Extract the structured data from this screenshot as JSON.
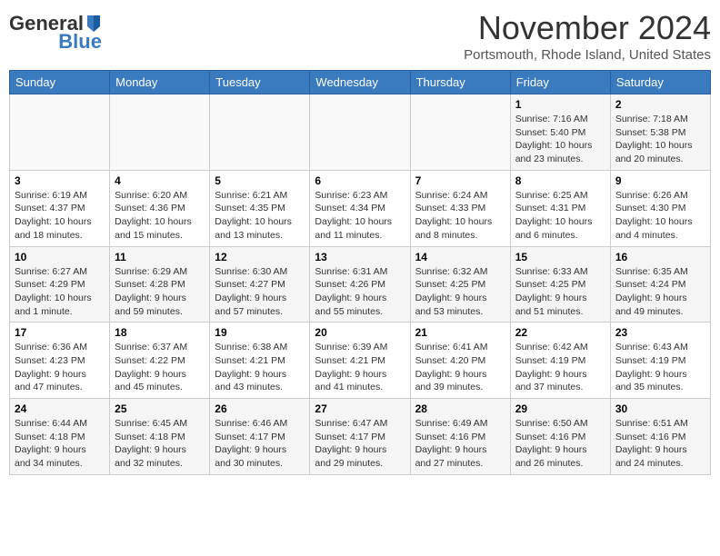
{
  "logo": {
    "general": "General",
    "blue": "Blue"
  },
  "header": {
    "month": "November 2024",
    "location": "Portsmouth, Rhode Island, United States"
  },
  "days_of_week": [
    "Sunday",
    "Monday",
    "Tuesday",
    "Wednesday",
    "Thursday",
    "Friday",
    "Saturday"
  ],
  "weeks": [
    [
      {
        "day": "",
        "info": ""
      },
      {
        "day": "",
        "info": ""
      },
      {
        "day": "",
        "info": ""
      },
      {
        "day": "",
        "info": ""
      },
      {
        "day": "",
        "info": ""
      },
      {
        "day": "1",
        "info": "Sunrise: 7:16 AM\nSunset: 5:40 PM\nDaylight: 10 hours and 23 minutes."
      },
      {
        "day": "2",
        "info": "Sunrise: 7:18 AM\nSunset: 5:38 PM\nDaylight: 10 hours and 20 minutes."
      }
    ],
    [
      {
        "day": "3",
        "info": "Sunrise: 6:19 AM\nSunset: 4:37 PM\nDaylight: 10 hours and 18 minutes."
      },
      {
        "day": "4",
        "info": "Sunrise: 6:20 AM\nSunset: 4:36 PM\nDaylight: 10 hours and 15 minutes."
      },
      {
        "day": "5",
        "info": "Sunrise: 6:21 AM\nSunset: 4:35 PM\nDaylight: 10 hours and 13 minutes."
      },
      {
        "day": "6",
        "info": "Sunrise: 6:23 AM\nSunset: 4:34 PM\nDaylight: 10 hours and 11 minutes."
      },
      {
        "day": "7",
        "info": "Sunrise: 6:24 AM\nSunset: 4:33 PM\nDaylight: 10 hours and 8 minutes."
      },
      {
        "day": "8",
        "info": "Sunrise: 6:25 AM\nSunset: 4:31 PM\nDaylight: 10 hours and 6 minutes."
      },
      {
        "day": "9",
        "info": "Sunrise: 6:26 AM\nSunset: 4:30 PM\nDaylight: 10 hours and 4 minutes."
      }
    ],
    [
      {
        "day": "10",
        "info": "Sunrise: 6:27 AM\nSunset: 4:29 PM\nDaylight: 10 hours and 1 minute."
      },
      {
        "day": "11",
        "info": "Sunrise: 6:29 AM\nSunset: 4:28 PM\nDaylight: 9 hours and 59 minutes."
      },
      {
        "day": "12",
        "info": "Sunrise: 6:30 AM\nSunset: 4:27 PM\nDaylight: 9 hours and 57 minutes."
      },
      {
        "day": "13",
        "info": "Sunrise: 6:31 AM\nSunset: 4:26 PM\nDaylight: 9 hours and 55 minutes."
      },
      {
        "day": "14",
        "info": "Sunrise: 6:32 AM\nSunset: 4:25 PM\nDaylight: 9 hours and 53 minutes."
      },
      {
        "day": "15",
        "info": "Sunrise: 6:33 AM\nSunset: 4:25 PM\nDaylight: 9 hours and 51 minutes."
      },
      {
        "day": "16",
        "info": "Sunrise: 6:35 AM\nSunset: 4:24 PM\nDaylight: 9 hours and 49 minutes."
      }
    ],
    [
      {
        "day": "17",
        "info": "Sunrise: 6:36 AM\nSunset: 4:23 PM\nDaylight: 9 hours and 47 minutes."
      },
      {
        "day": "18",
        "info": "Sunrise: 6:37 AM\nSunset: 4:22 PM\nDaylight: 9 hours and 45 minutes."
      },
      {
        "day": "19",
        "info": "Sunrise: 6:38 AM\nSunset: 4:21 PM\nDaylight: 9 hours and 43 minutes."
      },
      {
        "day": "20",
        "info": "Sunrise: 6:39 AM\nSunset: 4:21 PM\nDaylight: 9 hours and 41 minutes."
      },
      {
        "day": "21",
        "info": "Sunrise: 6:41 AM\nSunset: 4:20 PM\nDaylight: 9 hours and 39 minutes."
      },
      {
        "day": "22",
        "info": "Sunrise: 6:42 AM\nSunset: 4:19 PM\nDaylight: 9 hours and 37 minutes."
      },
      {
        "day": "23",
        "info": "Sunrise: 6:43 AM\nSunset: 4:19 PM\nDaylight: 9 hours and 35 minutes."
      }
    ],
    [
      {
        "day": "24",
        "info": "Sunrise: 6:44 AM\nSunset: 4:18 PM\nDaylight: 9 hours and 34 minutes."
      },
      {
        "day": "25",
        "info": "Sunrise: 6:45 AM\nSunset: 4:18 PM\nDaylight: 9 hours and 32 minutes."
      },
      {
        "day": "26",
        "info": "Sunrise: 6:46 AM\nSunset: 4:17 PM\nDaylight: 9 hours and 30 minutes."
      },
      {
        "day": "27",
        "info": "Sunrise: 6:47 AM\nSunset: 4:17 PM\nDaylight: 9 hours and 29 minutes."
      },
      {
        "day": "28",
        "info": "Sunrise: 6:49 AM\nSunset: 4:16 PM\nDaylight: 9 hours and 27 minutes."
      },
      {
        "day": "29",
        "info": "Sunrise: 6:50 AM\nSunset: 4:16 PM\nDaylight: 9 hours and 26 minutes."
      },
      {
        "day": "30",
        "info": "Sunrise: 6:51 AM\nSunset: 4:16 PM\nDaylight: 9 hours and 24 minutes."
      }
    ]
  ]
}
